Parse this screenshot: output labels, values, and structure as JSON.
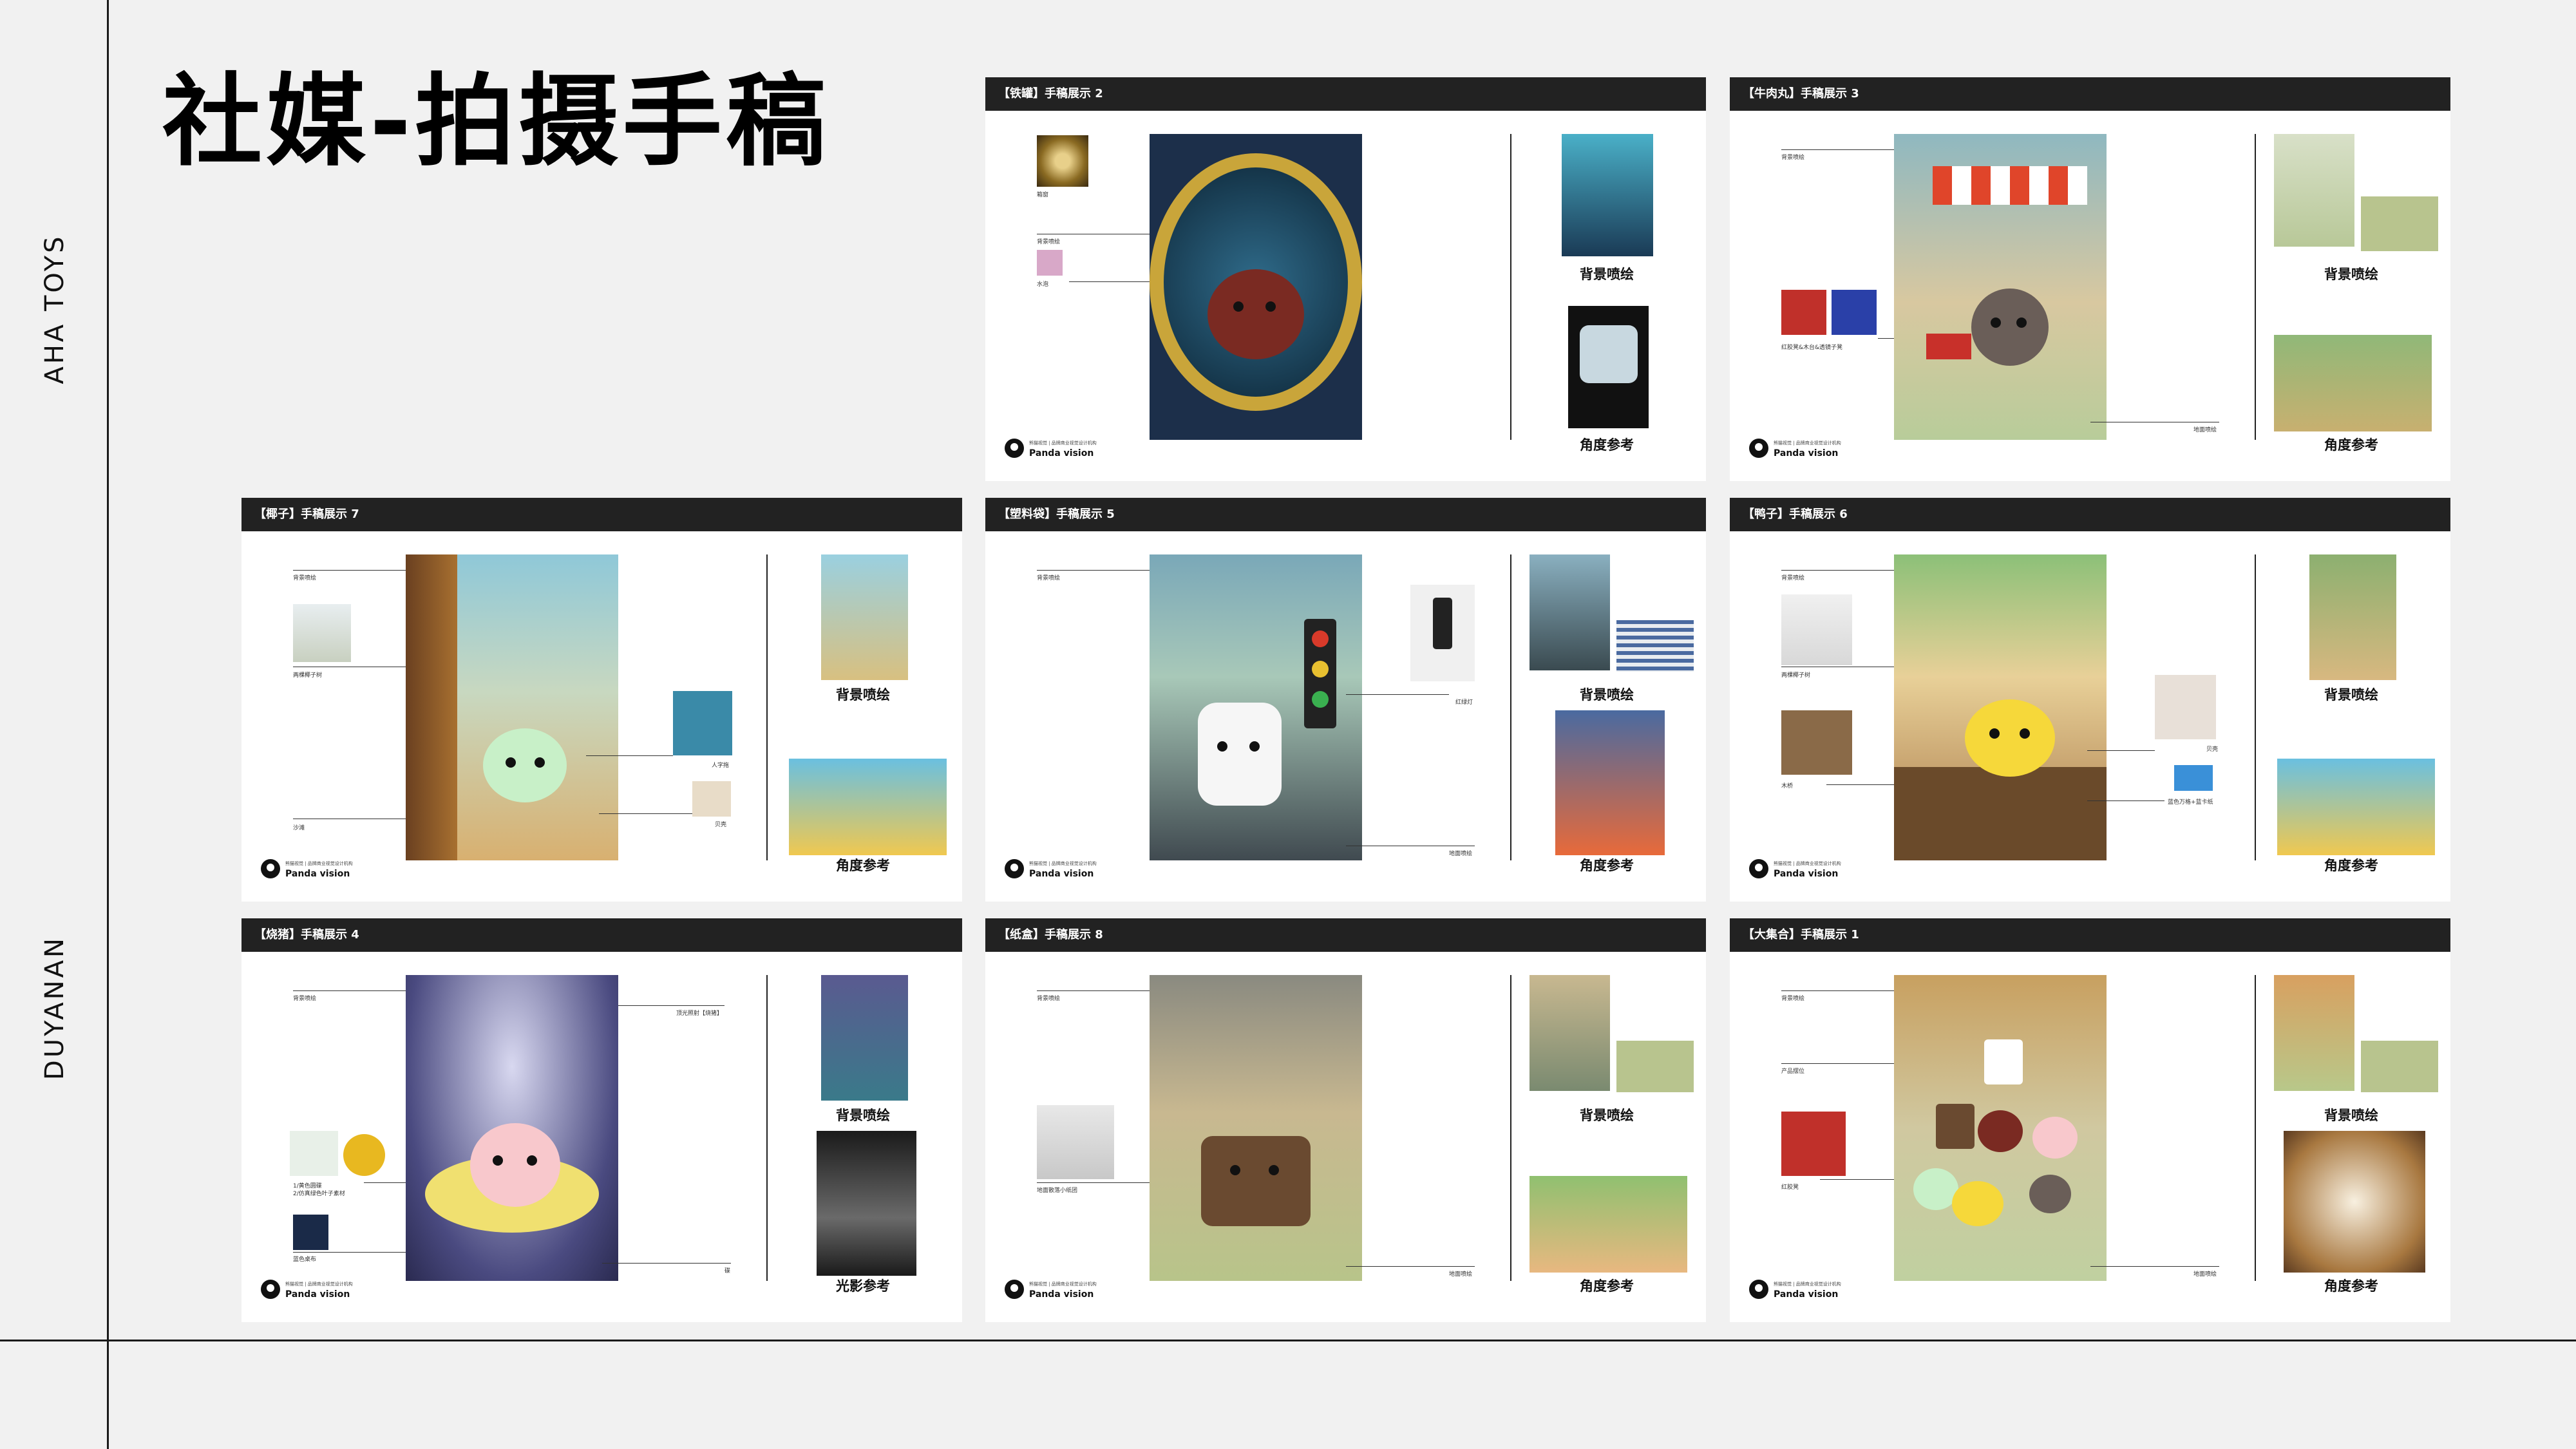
{
  "page": {
    "title": "社媒-拍摄手稿",
    "side_top": "AHA TOYS",
    "side_bottom": "DUYANAN"
  },
  "cards": [
    {
      "header": "【铁罐】手稿展示 2",
      "label1": "背景喷绘",
      "label2": "角度参考"
    },
    {
      "header": "【牛肉丸】手稿展示 3",
      "label1": "背景喷绘",
      "label2": "角度参考"
    },
    {
      "header": "【椰子】手稿展示 7",
      "label1": "背景喷绘",
      "label2": "角度参考"
    },
    {
      "header": "【塑料袋】手稿展示 5",
      "label1": "背景喷绘",
      "label2": "角度参考"
    },
    {
      "header": "【鸭子】手稿展示 6",
      "label1": "背景喷绘",
      "label2": "角度参考"
    },
    {
      "header": "【烧猪】手稿展示 4",
      "label1": "背景喷绘",
      "label2": "光影参考"
    },
    {
      "header": "【纸盒】手稿展示 8",
      "label1": "背景喷绘",
      "label2": "角度参考"
    },
    {
      "header": "【大集合】手稿展示 1",
      "label1": "背景喷绘",
      "label2": "角度参考"
    }
  ],
  "logo": {
    "name": "Panda vision",
    "tagline": "熊猫视觉 | 品牌商业视觉设计机构"
  },
  "annotations": {
    "c0": [
      "箱窗",
      "背景喷绘",
      "水泡"
    ],
    "c1": [
      "背景喷绘",
      "红胶凳&木台&透镜子凳",
      "地面喷绘"
    ],
    "c2": [
      "背景喷绘",
      "两棵椰子树",
      "沙滩",
      "人字拖",
      "贝壳",
      "沙地"
    ],
    "c3": [
      "背景喷绘",
      "红绿灯",
      "地面喷绘"
    ],
    "c4": [
      "背景喷绘",
      "两棵椰子树",
      "木桥",
      "贝壳",
      "蓝色万格+蓝卡纸",
      "海水"
    ],
    "c5": [
      "背景喷绘",
      "顶光照射【烧猪】",
      "1/黄色圆碟",
      "2/仿真绿色叶子素材",
      "蓝色桌布",
      "碟"
    ],
    "c6": [
      "背景喷绘",
      "地面散落小纸团",
      "地面喷绘"
    ],
    "c7": [
      "背景喷绘",
      "产品摆位",
      "红胶凳",
      "地面喷绘"
    ]
  },
  "colors": {
    "header_bg": "#222222",
    "page_bg": "#f1f1f1",
    "card_bg": "#ffffff"
  }
}
